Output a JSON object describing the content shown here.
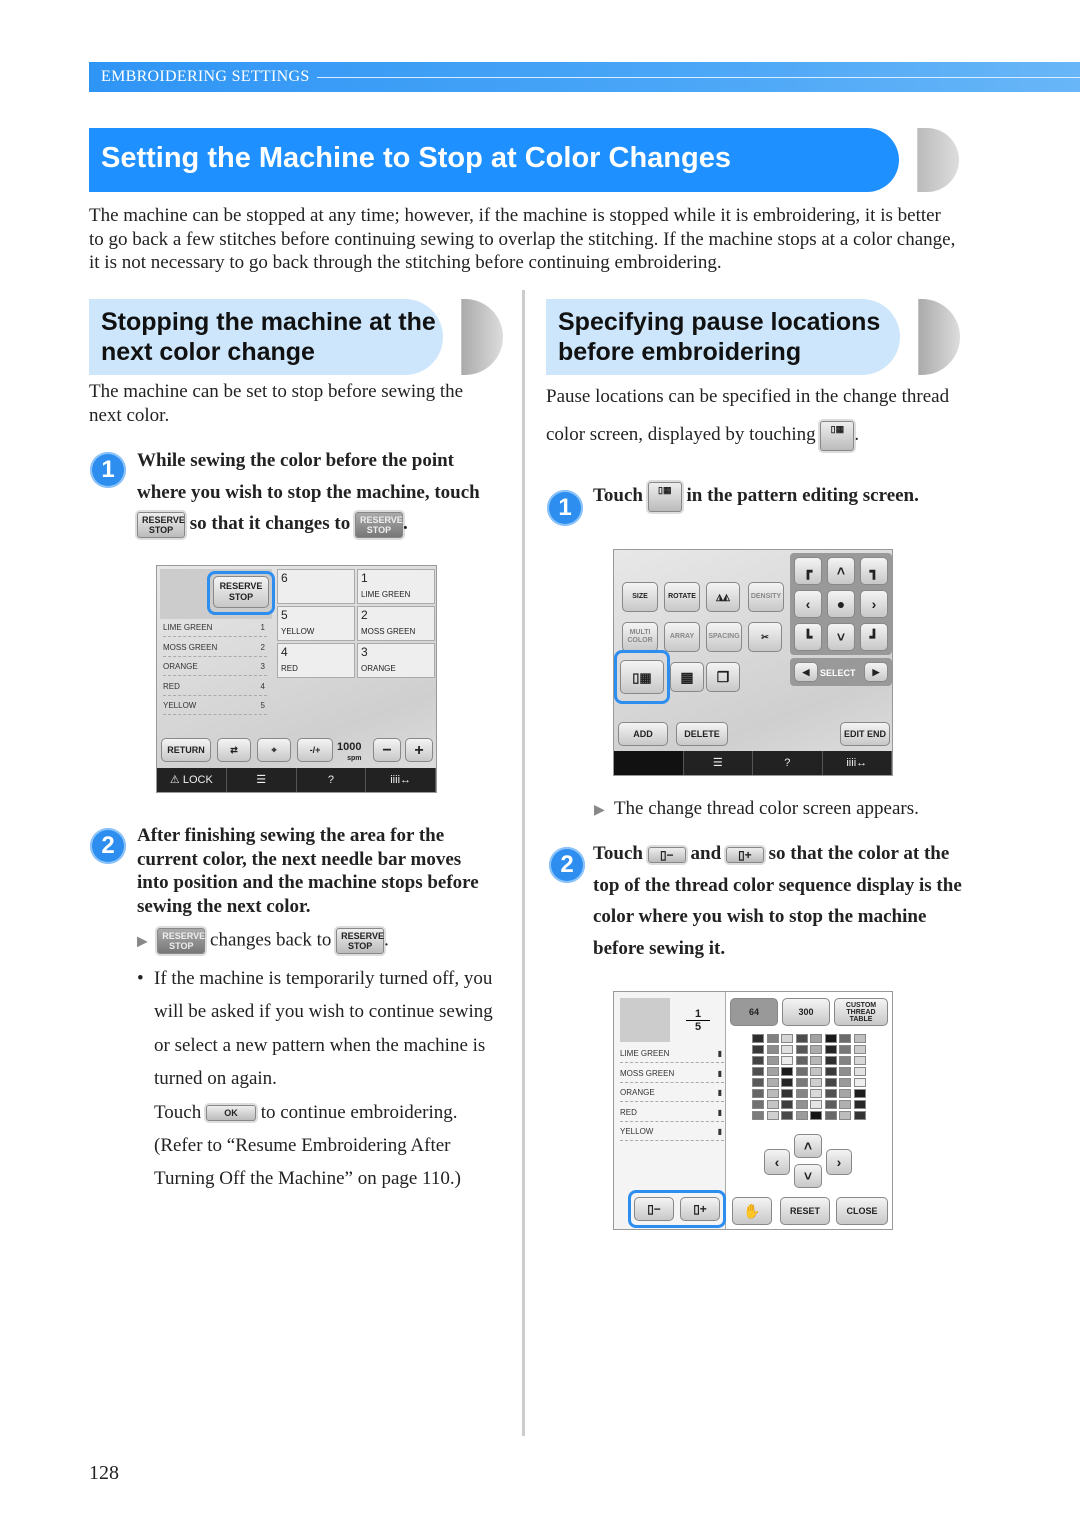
{
  "header": {
    "section": "EMBROIDERING SETTINGS"
  },
  "title": "Setting the Machine to Stop at Color Changes",
  "intro": "The machine can be stopped at any time; however, if the machine is stopped while it is embroidering, it is better to go back a few stitches before continuing sewing to overlap the stitching. If the machine stops at a color change, it is not necessary to go back through the stitching before continuing embroidering.",
  "left": {
    "heading": "Stopping the machine at the next color change",
    "desc": "The machine can be set to stop before sewing the next color.",
    "step1": {
      "num": "1",
      "text_a": "While sewing the color before the point where you wish to stop the machine, touch",
      "text_b": "so that it changes to",
      "text_c": "."
    },
    "step2": {
      "num": "2",
      "text": "After finishing sewing the area for the current color, the next needle bar moves into position and the machine stops before sewing the next color.",
      "result": "changes back to",
      "result_end": ".",
      "note": "If the machine is temporarily turned off, you will be asked if you wish to continue sewing or select a new pattern when the machine is turned on again.",
      "touch": "Touch",
      "touch_after": "to continue embroidering.",
      "refer": "(Refer to “Resume Embroidering After Turning Off the Machine” on page 110.)"
    },
    "screen": {
      "reserve": "RESERVE STOP",
      "colors": [
        "LIME GREEN",
        "MOSS GREEN",
        "ORANGE",
        "RED",
        "YELLOW"
      ],
      "numbers": [
        "1",
        "2",
        "3",
        "4",
        "5"
      ],
      "tiles": [
        {
          "n": "6",
          "c": ""
        },
        {
          "n": "1",
          "c": "LIME GREEN"
        },
        {
          "n": "5",
          "c": "YELLOW"
        },
        {
          "n": "2",
          "c": "MOSS GREEN"
        },
        {
          "n": "4",
          "c": "RED"
        },
        {
          "n": "3",
          "c": "ORANGE"
        }
      ],
      "return": "RETURN",
      "speed": "1000",
      "spm": "spm",
      "minus": "−",
      "plus": "+",
      "lock": "LOCK",
      "help": "?",
      "bar4": "iiii↔"
    }
  },
  "right": {
    "heading": "Specifying pause locations before embroidering",
    "desc_a": "Pause locations can be specified in the change thread color screen, displayed by touching",
    "desc_b": ".",
    "step1": {
      "num": "1",
      "touch": "Touch",
      "text": "in the pattern editing screen.",
      "result": "The change thread color screen appears."
    },
    "step2": {
      "num": "2",
      "touch": "Touch",
      "and": "and",
      "text": "so that the color at the top of the thread color sequence display is the color where you wish to stop the machine before sewing it."
    },
    "screen1": {
      "buttons": [
        "SIZE",
        "ROTATE",
        "DENSITY",
        "MULTI COLOR",
        "ARRAY",
        "SPACING"
      ],
      "select": "SELECT",
      "add": "ADD",
      "delete": "DELETE",
      "edit_end": "EDIT END",
      "help": "?",
      "bar4": "iiii↔"
    },
    "screen2": {
      "frac_top": "1",
      "frac_bottom": "5",
      "tab64": "64",
      "tab300": "300",
      "custom": "CUSTOM THREAD TABLE",
      "colors": [
        "LIME GREEN",
        "MOSS GREEN",
        "ORANGE",
        "RED",
        "YELLOW"
      ],
      "reset": "RESET",
      "close": "CLOSE"
    }
  },
  "inline": {
    "reserve_stop": "RESERVE STOP",
    "ok": "OK"
  },
  "page_number": "128",
  "colors": {
    "accent": "#1e90ff",
    "subheading_bg": "#cde6fb",
    "highlight": "#2e8ef0"
  }
}
